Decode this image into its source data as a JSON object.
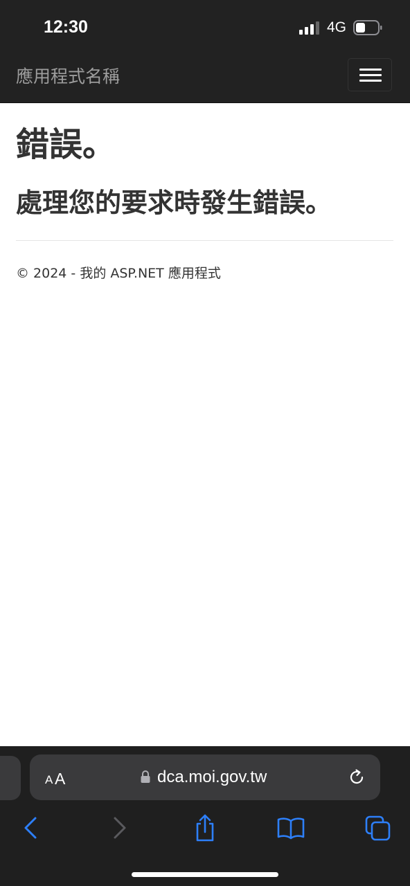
{
  "status_bar": {
    "time": "12:30",
    "network": "4G",
    "signal_bars_active": 3,
    "signal_bars_total": 4,
    "icons": {
      "signal": "cellular-signal-icon",
      "battery": "battery-icon"
    }
  },
  "navbar": {
    "brand": "應用程式名稱",
    "menu_icon": "hamburger-menu-icon"
  },
  "main": {
    "title": "錯誤。",
    "message": "處理您的要求時發生錯誤。",
    "footer": "© 2024 - 我的 ASP.NET 應用程式"
  },
  "browser": {
    "text_size_small": "A",
    "text_size_large": "A",
    "url": "dca.moi.gov.tw",
    "icons": {
      "lock": "lock-icon",
      "reload": "reload-icon",
      "back": "back-chevron-icon",
      "forward": "forward-chevron-icon",
      "share": "share-icon",
      "bookmarks": "bookmarks-icon",
      "tabs": "tabs-icon"
    }
  },
  "colors": {
    "navbar_bg": "#222222",
    "brand_text": "#9d9d9d",
    "body_text": "#333333",
    "browser_bg": "#1f1f1f",
    "address_bar_bg": "#3a3a3c",
    "accent_blue": "#2d7ff9",
    "disabled_gray": "#5a5a5e"
  }
}
